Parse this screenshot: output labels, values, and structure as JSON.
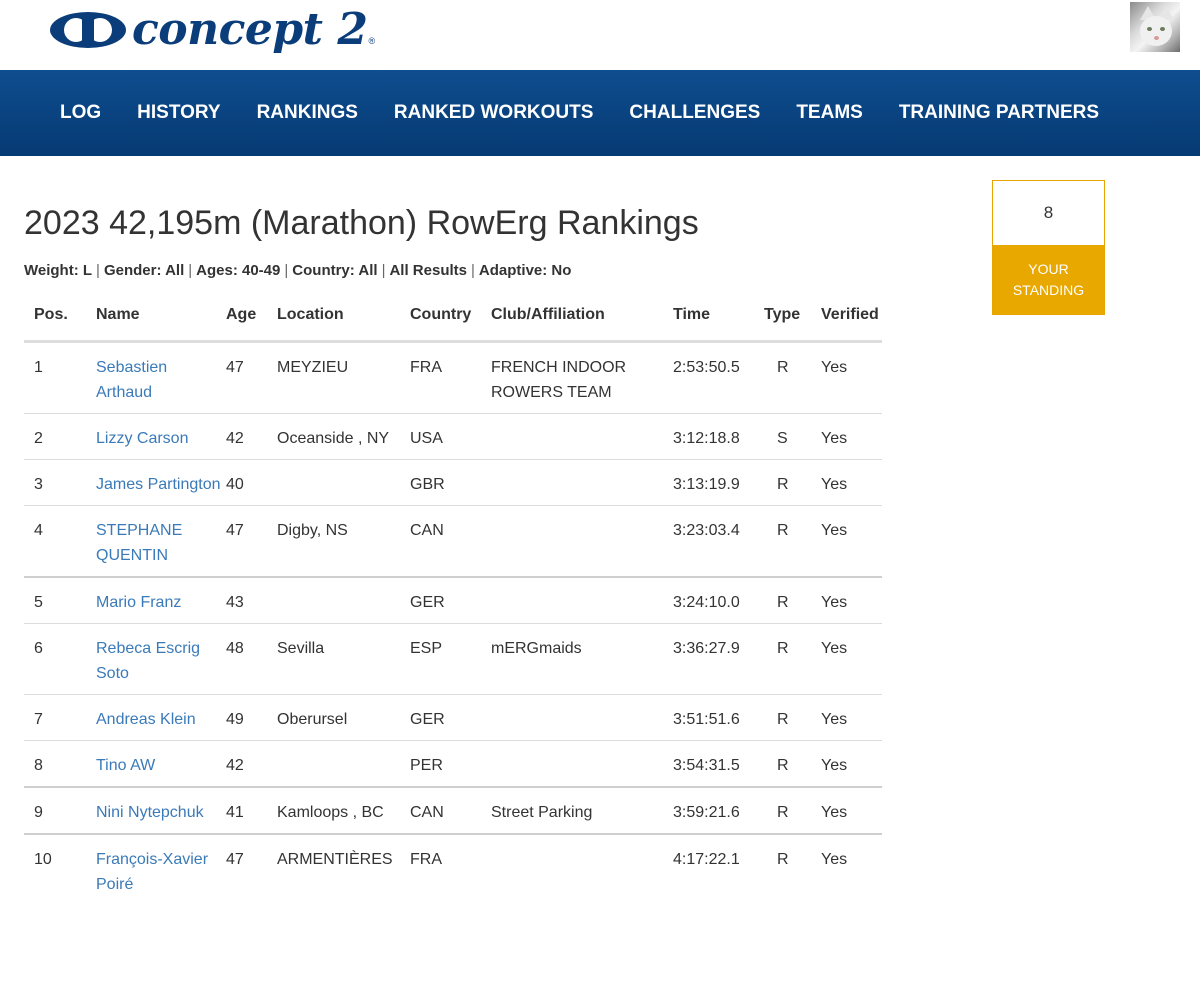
{
  "brand": {
    "logo_text": "concept 2",
    "logo_reg": "®"
  },
  "nav": {
    "items": [
      {
        "label": "LOG"
      },
      {
        "label": "HISTORY"
      },
      {
        "label": "RANKINGS"
      },
      {
        "label": "RANKED WORKOUTS"
      },
      {
        "label": "CHALLENGES"
      },
      {
        "label": "TEAMS"
      },
      {
        "label": "TRAINING PARTNERS"
      }
    ]
  },
  "page": {
    "title": "2023 42,195m (Marathon) RowErg Rankings"
  },
  "filters": [
    "Weight: L",
    "Gender: All",
    "Ages: 40-49",
    "Country: All",
    "All Results",
    "Adaptive: No"
  ],
  "table": {
    "headers": {
      "pos": "Pos.",
      "name": "Name",
      "age": "Age",
      "location": "Location",
      "country": "Country",
      "club": "Club/Affiliation",
      "time": "Time",
      "type": "Type",
      "verified": "Verified"
    },
    "rows": [
      {
        "pos": "1",
        "name": "Sebastien Arthaud",
        "age": "47",
        "location": "MEYZIEU",
        "country": "FRA",
        "club": "FRENCH INDOOR ROWERS TEAM",
        "time": "2:53:50.5",
        "type": "R",
        "verified": "Yes"
      },
      {
        "pos": "2",
        "name": "Lizzy Carson",
        "age": "42",
        "location": "Oceanside , NY",
        "country": "USA",
        "club": "",
        "time": "3:12:18.8",
        "type": "S",
        "verified": "Yes"
      },
      {
        "pos": "3",
        "name": "James Partington",
        "age": "40",
        "location": "",
        "country": "GBR",
        "club": "",
        "time": "3:13:19.9",
        "type": "R",
        "verified": "Yes"
      },
      {
        "pos": "4",
        "name": "STEPHANE QUENTIN",
        "age": "47",
        "location": "Digby, NS",
        "country": "CAN",
        "club": "",
        "time": "3:23:03.4",
        "type": "R",
        "verified": "Yes"
      },
      {
        "pos": "5",
        "name": "Mario Franz",
        "age": "43",
        "location": "",
        "country": "GER",
        "club": "",
        "time": "3:24:10.0",
        "type": "R",
        "verified": "Yes"
      },
      {
        "pos": "6",
        "name": "Rebeca Escrig Soto",
        "age": "48",
        "location": "Sevilla",
        "country": "ESP",
        "club": "mERGmaids",
        "time": "3:36:27.9",
        "type": "R",
        "verified": "Yes"
      },
      {
        "pos": "7",
        "name": "Andreas Klein",
        "age": "49",
        "location": "Oberursel",
        "country": "GER",
        "club": "",
        "time": "3:51:51.6",
        "type": "R",
        "verified": "Yes"
      },
      {
        "pos": "8",
        "name": "Tino AW",
        "age": "42",
        "location": "",
        "country": "PER",
        "club": "",
        "time": "3:54:31.5",
        "type": "R",
        "verified": "Yes"
      },
      {
        "pos": "9",
        "name": "Nini Nytepchuk",
        "age": "41",
        "location": "Kamloops , BC",
        "country": "CAN",
        "club": "Street Parking",
        "time": "3:59:21.6",
        "type": "R",
        "verified": "Yes"
      },
      {
        "pos": "10",
        "name": "François-Xavier Poiré",
        "age": "47",
        "location": "ARMENTIÈRES",
        "country": "FRA",
        "club": "",
        "time": "4:17:22.1",
        "type": "R",
        "verified": "Yes"
      }
    ]
  },
  "standing": {
    "value": "8",
    "label": "YOUR STANDING"
  },
  "colors": {
    "nav_bg": "#0a4585",
    "link": "#3a7ab8",
    "standing_accent": "#e8a800",
    "logo": "#0b3d7a"
  }
}
